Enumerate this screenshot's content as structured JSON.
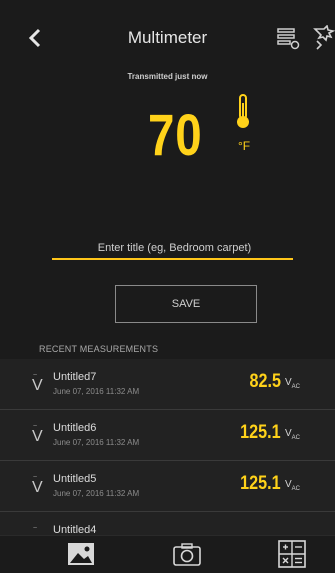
{
  "header": {
    "title": "Multimeter",
    "icons": [
      "back-chevron-icon",
      "data-list-icon",
      "logo-icon"
    ]
  },
  "status": {
    "transmitted": "Transmitted just now"
  },
  "reading": {
    "value": "70",
    "unit": "°F",
    "icon": "thermometer-icon"
  },
  "title_input": {
    "placeholder": "Enter title (eg, Bedroom carpet)",
    "value": ""
  },
  "save_label": "SAVE",
  "recent": {
    "header": "RECENT MEASUREMENTS",
    "items": [
      {
        "name": "Untitled7",
        "date": "June 07, 2016 11:32 AM",
        "value": "82.5",
        "unit": "V",
        "sub": "AC"
      },
      {
        "name": "Untitled6",
        "date": "June 07, 2016 11:32 AM",
        "value": "125.1",
        "unit": "V",
        "sub": "AC"
      },
      {
        "name": "Untitled5",
        "date": "June 07, 2016 11:32 AM",
        "value": "125.1",
        "unit": "V",
        "sub": "AC"
      },
      {
        "name": "Untitled4",
        "date": "",
        "value": "",
        "unit": "",
        "sub": ""
      }
    ]
  },
  "tabs": [
    "gallery-icon",
    "camera-icon",
    "calculator-icon"
  ],
  "colors": {
    "accent": "#ffd21a",
    "background": "#1b1b1b"
  }
}
